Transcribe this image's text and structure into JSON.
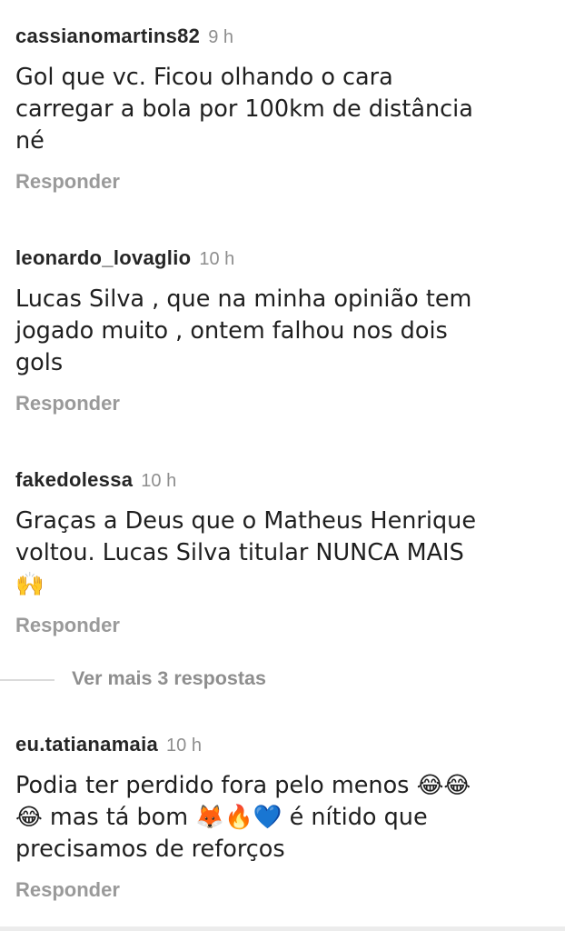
{
  "comments": [
    {
      "username": "cassianomartins82",
      "time": "9 h",
      "text": "Gol que vc. Ficou olhando o cara\ncarregar a bola por 100km de distância\nné",
      "reply_label": "Responder"
    },
    {
      "username": "leonardo_lovaglio",
      "time": "10 h",
      "text": "Lucas Silva , que na minha opinião tem\njogado muito , ontem falhou nos dois\ngols",
      "reply_label": "Responder"
    },
    {
      "username": "fakedolessa",
      "time": "10 h",
      "text": "Graças a Deus que o Matheus Henrique\nvoltou. Lucas Silva titular NUNCA MAIS\n🙌",
      "reply_label": "Responder"
    },
    {
      "username": "eu.tatianamaia",
      "time": "10 h",
      "text": "Podia ter perdido fora pelo menos 😂😂\n😂 mas tá bom 🦊🔥💙 é nítido que\nprecisamos de reforços",
      "reply_label": "Responder"
    }
  ],
  "view_more_replies": "Ver mais 3 respostas"
}
